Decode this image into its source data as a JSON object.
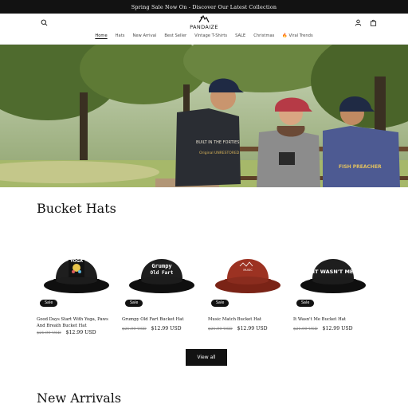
{
  "announcement": "Spring Sale Now On - Discover Our Latest Collection",
  "brand": {
    "name": "PANDAIZE"
  },
  "nav": [
    {
      "label": "Home",
      "active": true
    },
    {
      "label": "Hats",
      "active": false
    },
    {
      "label": "New Arrival",
      "active": false
    },
    {
      "label": "Best Seller",
      "active": false
    },
    {
      "label": "Vintage T-Shirts",
      "active": false
    },
    {
      "label": "SALE",
      "active": false
    },
    {
      "label": "Christmas",
      "active": false
    },
    {
      "label": "🔥 Viral Trends",
      "active": false
    }
  ],
  "hero": {
    "shirt_1": "BUILT IN THE FORTIES",
    "shirt_2": "Original UNRESTORED",
    "shirt_3": "FISH PREACHER"
  },
  "sections": {
    "bucket_hats": "Bucket Hats",
    "new_arrivals": "New Arrivals"
  },
  "products": [
    {
      "title": "Good Days Start With Yoga, Paws And Breath Bucket Hat",
      "badge": "Sale",
      "compare_price": "$21.99 USD",
      "price": "$12.99 USD",
      "hat_color": "#121212",
      "print": "YOGA"
    },
    {
      "title": "Grumpy Old Fart Bucket Hat",
      "badge": "Sale",
      "compare_price": "$21.99 USD",
      "price": "$12.99 USD",
      "hat_color": "#121212",
      "print": "Grumpy Old Fart"
    },
    {
      "title": "Music Match Bucket Hat",
      "badge": "Sale",
      "compare_price": "$21.99 USD",
      "price": "$12.99 USD",
      "hat_color": "#8e2a1c",
      "print": "MUSIC"
    },
    {
      "title": "It Wasn't Me Bucket Hat",
      "badge": "Sale",
      "compare_price": "$21.99 USD",
      "price": "$12.99 USD",
      "hat_color": "#121212",
      "print": "IT WASN'T ME"
    }
  ],
  "view_all": "View all",
  "colors": {
    "dark": "#121212",
    "announcement_bg": "#121212",
    "button_bg": "#121212"
  }
}
